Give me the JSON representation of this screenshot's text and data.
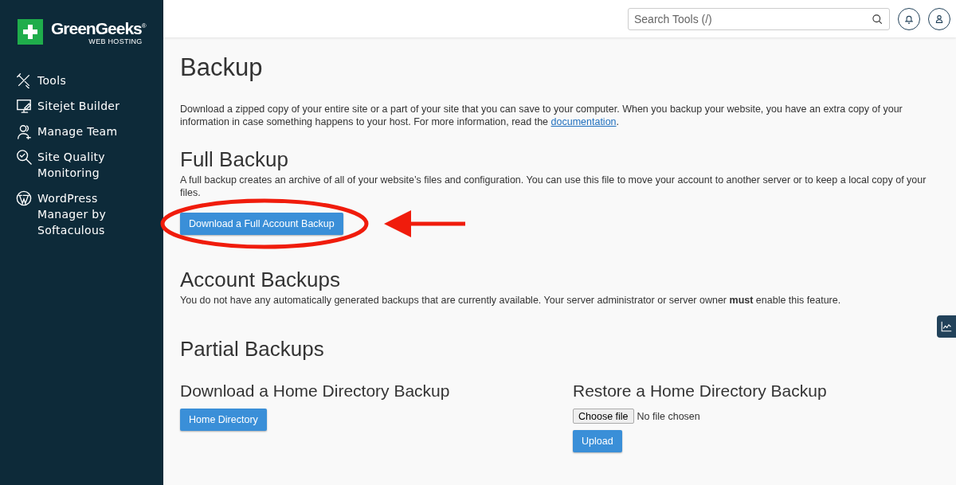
{
  "sidebar": {
    "logo": {
      "name": "GreenGeeks$^{®}$",
      "tagline": "WEB HOSTING"
    },
    "items": [
      {
        "kind": "tools",
        "label": "Tools"
      },
      {
        "kind": "builder",
        "label": "Sitejet Builder"
      },
      {
        "kind": "team",
        "label": "Manage Team"
      },
      {
        "kind": "quality",
        "label": "Site Quality Monitoring"
      },
      {
        "kind": "wordpress",
        "label": "WordPress Manager by Softaculous"
      }
    ]
  },
  "header": {
    "search": {
      "placeholder": "Search Tools (/)"
    }
  },
  "page": {
    "title": "Backup",
    "intro": {
      "text": "Download a zipped copy of your entire site or a part of your site that you can save to your computer. When you backup your website, you have an extra copy of your information in case something happens to your host. For more information, read the ",
      "link": "documentation",
      "after": "."
    },
    "full_backup": {
      "heading": "Full Backup",
      "text": "A full backup creates an archive of all of your website’s files and configuration. You can use this file to move your account to another server or to keep a local copy of your files.",
      "button": "Download a Full Account Backup"
    },
    "account_backups": {
      "heading": "Account Backups",
      "text": "You do not have any automatically generated backups that are currently available. Your server administrator or server owner **must** enable this feature."
    },
    "partial_backups": {
      "heading": "Partial Backups",
      "download": {
        "heading": "Download a Home Directory Backup",
        "button": "Home Directory"
      },
      "restore": {
        "heading": "Restore a Home Directory Backup",
        "file_button": "Choose file",
        "file_status": "No file chosen",
        "button": "Upload"
      }
    }
  }
}
